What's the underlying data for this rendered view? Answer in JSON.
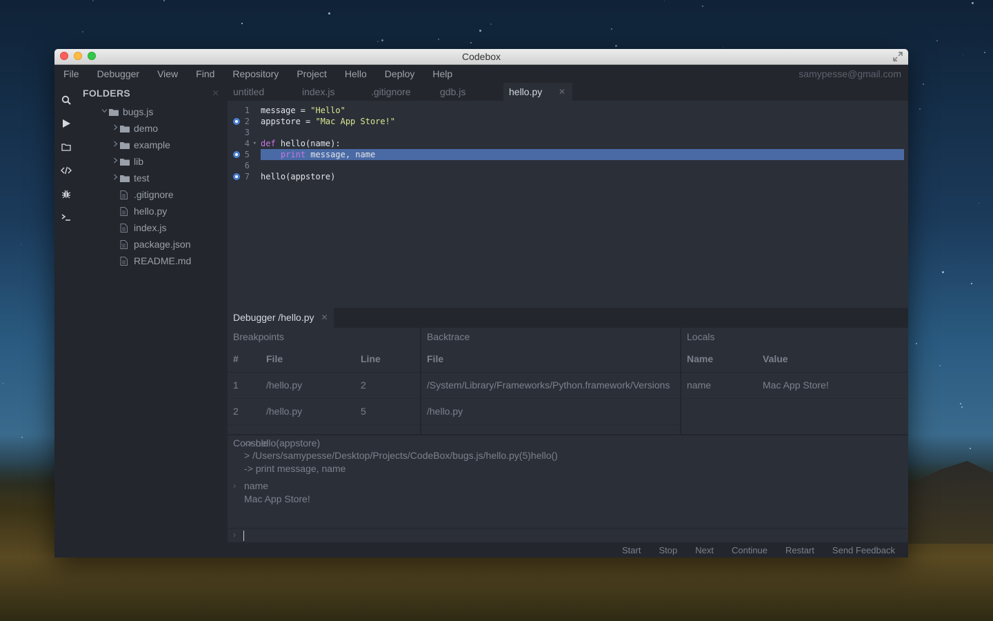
{
  "window": {
    "title": "Codebox"
  },
  "menu": {
    "items": [
      "File",
      "Debugger",
      "View",
      "Find",
      "Repository",
      "Project",
      "Hello",
      "Deploy",
      "Help"
    ],
    "user": "samypesse@gmail.com"
  },
  "sidebar": {
    "header": "FOLDERS",
    "tree": [
      {
        "label": "bugs.js",
        "type": "folder",
        "expanded": true,
        "depth": 0
      },
      {
        "label": "demo",
        "type": "folder",
        "expanded": false,
        "depth": 1
      },
      {
        "label": "example",
        "type": "folder",
        "expanded": false,
        "depth": 1
      },
      {
        "label": "lib",
        "type": "folder",
        "expanded": false,
        "depth": 1
      },
      {
        "label": "test",
        "type": "folder",
        "expanded": false,
        "depth": 1
      },
      {
        "label": ".gitignore",
        "type": "file",
        "depth": 1
      },
      {
        "label": "hello.py",
        "type": "file",
        "depth": 1
      },
      {
        "label": "index.js",
        "type": "file",
        "depth": 1
      },
      {
        "label": "package.json",
        "type": "file",
        "depth": 1
      },
      {
        "label": "README.md",
        "type": "file",
        "depth": 1
      }
    ]
  },
  "icons": [
    "search-icon",
    "run-icon",
    "folder-icon",
    "code-icon",
    "debug-icon",
    "terminal-icon"
  ],
  "tabs": [
    {
      "label": "untitled",
      "active": false
    },
    {
      "label": "index.js",
      "active": false
    },
    {
      "label": ".gitignore",
      "active": false
    },
    {
      "label": "gdb.js",
      "active": false
    },
    {
      "label": "hello.py",
      "active": true
    }
  ],
  "editor": {
    "lines": [
      {
        "n": "1",
        "text": "message = \"Hello\"",
        "breakpoint": false
      },
      {
        "n": "2",
        "text": "appstore = \"Mac App Store!\"",
        "breakpoint": true
      },
      {
        "n": "3",
        "text": "",
        "breakpoint": false
      },
      {
        "n": "4",
        "text": "def hello(name):",
        "breakpoint": false,
        "fold": true
      },
      {
        "n": "5",
        "text": "    print message, name",
        "breakpoint": true,
        "highlight": true
      },
      {
        "n": "6",
        "text": "",
        "breakpoint": false
      },
      {
        "n": "7",
        "text": "hello(appstore)",
        "breakpoint": true
      }
    ]
  },
  "debugger": {
    "tab": "Debugger /hello.py",
    "breakpoints": {
      "title": "Breakpoints",
      "columns": [
        "#",
        "File",
        "Line"
      ],
      "rows": [
        [
          "1",
          "/hello.py",
          "2"
        ],
        [
          "2",
          "/hello.py",
          "5"
        ]
      ]
    },
    "backtrace": {
      "title": "Backtrace",
      "columns": [
        "File"
      ],
      "rows": [
        [
          "/System/Library/Frameworks/Python.framework/Versions"
        ],
        [
          "/hello.py"
        ]
      ]
    },
    "locals": {
      "title": "Locals",
      "columns": [
        "Name",
        "Value"
      ],
      "rows": [
        [
          "name",
          "Mac App Store!"
        ]
      ]
    },
    "console": {
      "title": "Console",
      "lines": [
        {
          "text": "-> hello(appstore)",
          "prompt": false
        },
        {
          "text": "> /Users/samypesse/Desktop/Projects/CodeBox/bugs.js/hello.py(5)hello()",
          "prompt": false
        },
        {
          "text": "-> print message, name",
          "prompt": false
        },
        {
          "text": "name",
          "prompt": true
        },
        {
          "text": "Mac App Store!",
          "prompt": false
        }
      ]
    }
  },
  "statusbar": {
    "buttons": [
      "Start",
      "Stop",
      "Next",
      "Continue",
      "Restart",
      "Send Feedback"
    ]
  },
  "colors": {
    "accent": "#4a7fd1",
    "selection": "#4a6aa5",
    "panel": "#23262d",
    "editor_bg": "#2b2f38"
  }
}
